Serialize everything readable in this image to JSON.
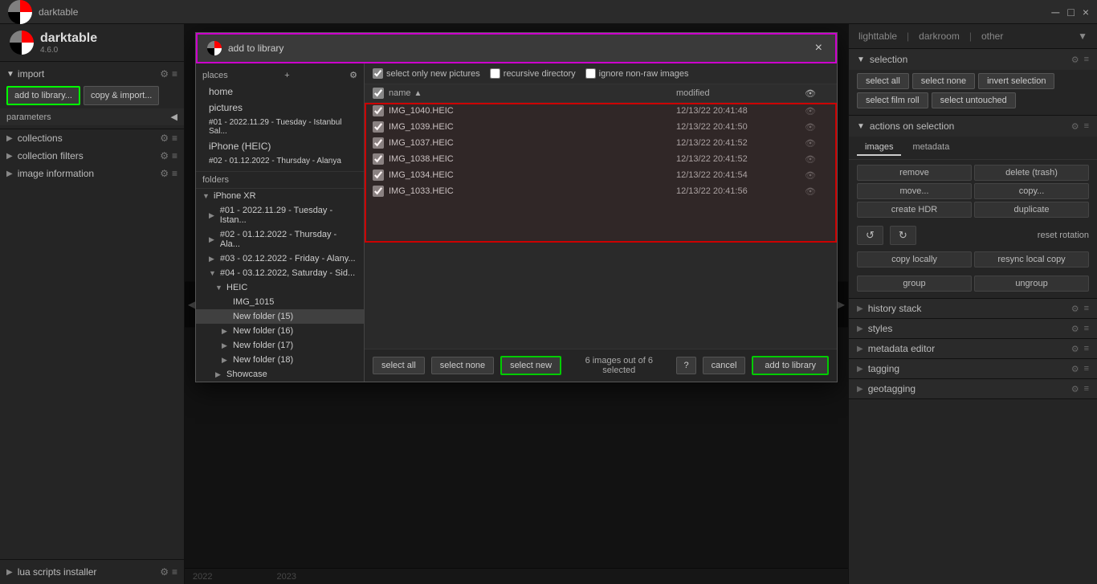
{
  "app": {
    "title": "darktable",
    "version": "4.6.0"
  },
  "titlebar": {
    "title": "darktable",
    "minimize": "─",
    "maximize": "□",
    "close": "×"
  },
  "left_sidebar": {
    "logo_text": "darktable",
    "version": "4.6.0",
    "import_section": "import",
    "add_library_btn": "add to library...",
    "copy_import_btn": "copy & import...",
    "parameters_label": "parameters",
    "collections_label": "collections",
    "collection_filters_label": "collection filters",
    "image_information_label": "image information",
    "lua_scripts_label": "lua scripts installer"
  },
  "dialog": {
    "title": "add to library",
    "places_label": "places",
    "places": [
      "home",
      "pictures",
      "#01 - 2022.11.29 - Tuesday - Istanbul Sal...",
      "iPhone (HEIC)",
      "#02 - 01.12.2022 - Thursday - Alanya"
    ],
    "folders_label": "folders",
    "tree": [
      {
        "label": "iPhone XR",
        "indent": 0,
        "expanded": true,
        "arrow": "▼"
      },
      {
        "label": "#01 - 2022.11.29 - Tuesday - Istan...",
        "indent": 1,
        "expanded": false,
        "arrow": "▶"
      },
      {
        "label": "#02 - 01.12.2022 - Thursday - Ala...",
        "indent": 1,
        "expanded": false,
        "arrow": "▶"
      },
      {
        "label": "#03 - 02.12.2022 - Friday - Alany...",
        "indent": 1,
        "expanded": false,
        "arrow": "▶"
      },
      {
        "label": "#04 - 03.12.2022, Saturday - Sid...",
        "indent": 1,
        "expanded": true,
        "arrow": "▼"
      },
      {
        "label": "HEIC",
        "indent": 2,
        "expanded": true,
        "arrow": "▼"
      },
      {
        "label": "IMG_1015",
        "indent": 3,
        "expanded": false,
        "arrow": ""
      },
      {
        "label": "New folder (15)",
        "indent": 3,
        "expanded": false,
        "arrow": "",
        "selected": true
      },
      {
        "label": "New folder (16)",
        "indent": 3,
        "expanded": false,
        "arrow": "▶"
      },
      {
        "label": "New folder (17)",
        "indent": 3,
        "expanded": false,
        "arrow": "▶"
      },
      {
        "label": "New folder (18)",
        "indent": 3,
        "expanded": false,
        "arrow": "▶"
      },
      {
        "label": "Showcase",
        "indent": 2,
        "expanded": false,
        "arrow": "▶"
      }
    ],
    "toolbar": {
      "select_only_new": "select only new pictures",
      "recursive_directory": "recursive directory",
      "ignore_non_raw": "ignore non-raw images",
      "select_only_new_checked": true,
      "recursive_checked": false,
      "ignore_non_raw_checked": false
    },
    "file_list_headers": {
      "name": "name",
      "modified": "modified",
      "eye": ""
    },
    "files": [
      {
        "name": "IMG_1040.HEIC",
        "modified": "12/13/22 20:41:48",
        "selected": true
      },
      {
        "name": "IMG_1039.HEIC",
        "modified": "12/13/22 20:41:50",
        "selected": true
      },
      {
        "name": "IMG_1037.HEIC",
        "modified": "12/13/22 20:41:52",
        "selected": true
      },
      {
        "name": "IMG_1038.HEIC",
        "modified": "12/13/22 20:41:52",
        "selected": true
      },
      {
        "name": "IMG_1034.HEIC",
        "modified": "12/13/22 20:41:54",
        "selected": true
      },
      {
        "name": "IMG_1033.HEIC",
        "modified": "12/13/22 20:41:56",
        "selected": true
      }
    ],
    "footer": {
      "select_all": "select all",
      "select_none": "select none",
      "select_new": "select new",
      "status": "6 images out of 6 selected",
      "help": "?",
      "cancel": "cancel",
      "add_to_library": "add to library"
    }
  },
  "right_sidebar": {
    "nav": {
      "lighttable": "lighttable",
      "darkroom": "darkroom",
      "other": "other"
    },
    "selection": {
      "title": "selection",
      "select_all": "select all",
      "select_none": "select none",
      "invert_selection": "invert selection",
      "select_film_roll": "select film roll",
      "select_untouched": "select untouched"
    },
    "actions": {
      "title": "actions on selection",
      "tab_images": "images",
      "tab_metadata": "metadata",
      "remove": "remove",
      "delete_trash": "delete (trash)",
      "move": "move...",
      "copy": "copy...",
      "create_hdr": "create HDR",
      "duplicate": "duplicate",
      "reset_rotation": "reset rotation",
      "copy_locally": "copy locally",
      "resync_local_copy": "resync local copy",
      "group": "group",
      "ungroup": "ungroup"
    },
    "history_stack": {
      "title": "history stack"
    },
    "styles": {
      "title": "styles"
    },
    "metadata_editor": {
      "title": "metadata editor"
    },
    "tagging": {
      "title": "tagging"
    },
    "geotagging": {
      "title": "geotagging"
    }
  },
  "timeline": {
    "year_2022": "2022",
    "year_2023": "2023"
  }
}
